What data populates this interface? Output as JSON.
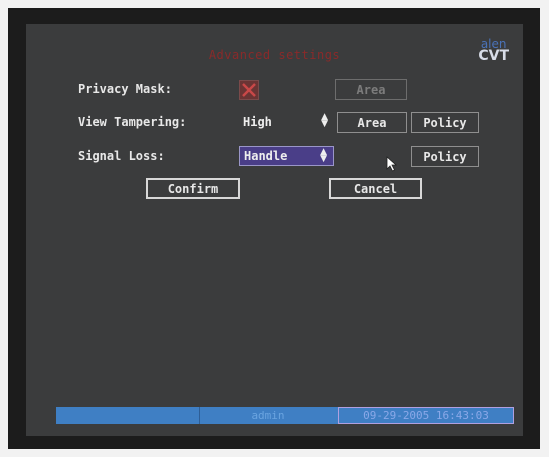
{
  "dialog": {
    "title": "Advanced settings",
    "logo_top": "alen",
    "logo_bottom": "CVT"
  },
  "rows": {
    "privacy_mask": {
      "label": "Privacy Mask:",
      "checked": false,
      "area_button": "Area"
    },
    "view_tampering": {
      "label": "View Tampering:",
      "value": "High",
      "area_button": "Area",
      "policy_button": "Policy"
    },
    "signal_loss": {
      "label": "Signal Loss:",
      "value": "Handle",
      "policy_button": "Policy"
    }
  },
  "actions": {
    "confirm_label": "Confirm",
    "cancel_label": "Cancel"
  },
  "status_bar": {
    "user": "admin",
    "datetime": "09-29-2005 16:43:03"
  },
  "icons": {
    "checkbox_mark": "x-mark-icon",
    "spinner": "up-down-arrows-icon",
    "pointer": "mouse-cursor-icon"
  },
  "colors": {
    "screen_bg": "#3b3c3d",
    "active_select": "#4a3e88",
    "status_bar": "#3f7fc4",
    "checkbox_x": "#c84848"
  }
}
